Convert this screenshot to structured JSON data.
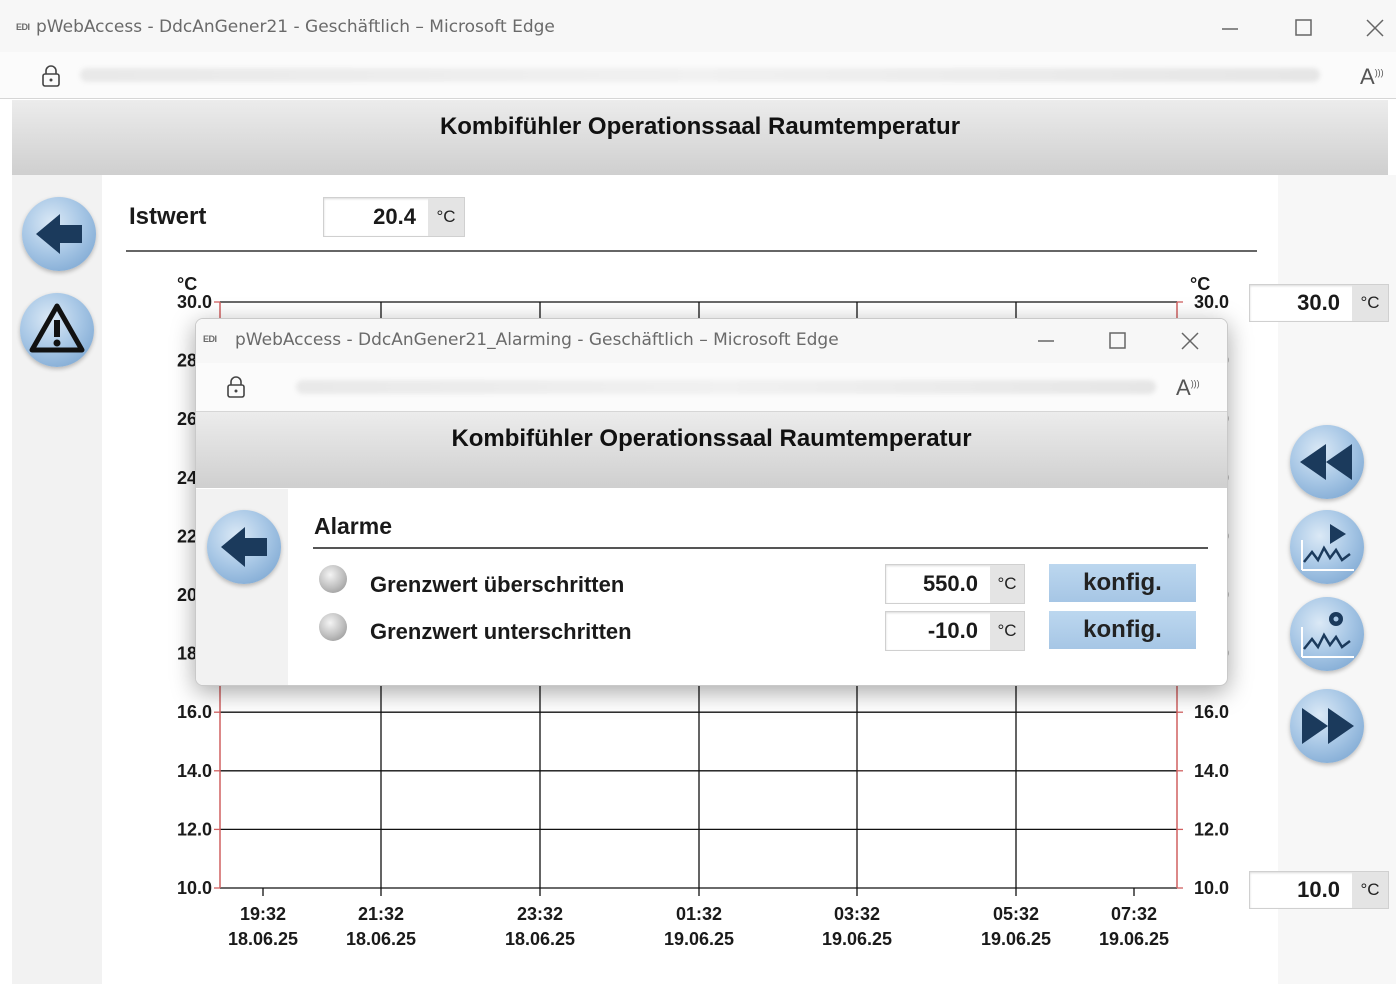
{
  "browser": {
    "logo": "EDI",
    "title": "pWebAccess - DdcAnGener21 - Geschäftlich – Microsoft Edge",
    "minimize_icon": "minimize-icon",
    "maximize_icon": "maximize-icon",
    "close_icon": "close-icon",
    "read_aloud_label": "A",
    "read_aloud_waves": ")))"
  },
  "page": {
    "title": "Kombifühler Operationssaal Raumtemperatur",
    "istwert_label": "Istwert",
    "istwert_value": "20.4",
    "unit": "°C",
    "max_value": "30.0",
    "min_value": "10.0"
  },
  "chart_data": {
    "type": "line",
    "left_axis_unit": "°C",
    "right_axis_unit": "°C",
    "ylim": [
      10.0,
      30.0
    ],
    "y_ticks": [
      "30.0",
      "28.0",
      "26.0",
      "24.0",
      "22.0",
      "20.0",
      "18.0",
      "16.0",
      "14.0",
      "12.0",
      "10.0"
    ],
    "x_ticks": [
      {
        "time": "19:32",
        "date": "18.06.25"
      },
      {
        "time": "21:32",
        "date": "18.06.25"
      },
      {
        "time": "23:32",
        "date": "18.06.25"
      },
      {
        "time": "01:32",
        "date": "19.06.25"
      },
      {
        "time": "03:32",
        "date": "19.06.25"
      },
      {
        "time": "05:32",
        "date": "19.06.25"
      },
      {
        "time": "07:32",
        "date": "19.06.25"
      }
    ],
    "grid": true,
    "series": []
  },
  "popup": {
    "logo": "EDI",
    "title": "pWebAccess - DdcAnGener21_Alarming - Geschäftlich – Microsoft Edge",
    "read_aloud_label": "A",
    "read_aloud_waves": ")))",
    "header_title": "Kombifühler Operationssaal Raumtemperatur",
    "alarms_heading": "Alarme",
    "alarms": [
      {
        "label": "Grenzwert überschritten",
        "value": "550.0",
        "unit": "°C",
        "button": "konfig."
      },
      {
        "label": "Grenzwert unterschritten",
        "value": "-10.0",
        "unit": "°C",
        "button": "konfig."
      }
    ]
  },
  "colors": {
    "button_blue": "#a9c8e6",
    "button_dark": "#1b3a5c",
    "konfig_bg": "#b4d0eb",
    "axis_red": "#d06060",
    "grid": "#111111"
  }
}
